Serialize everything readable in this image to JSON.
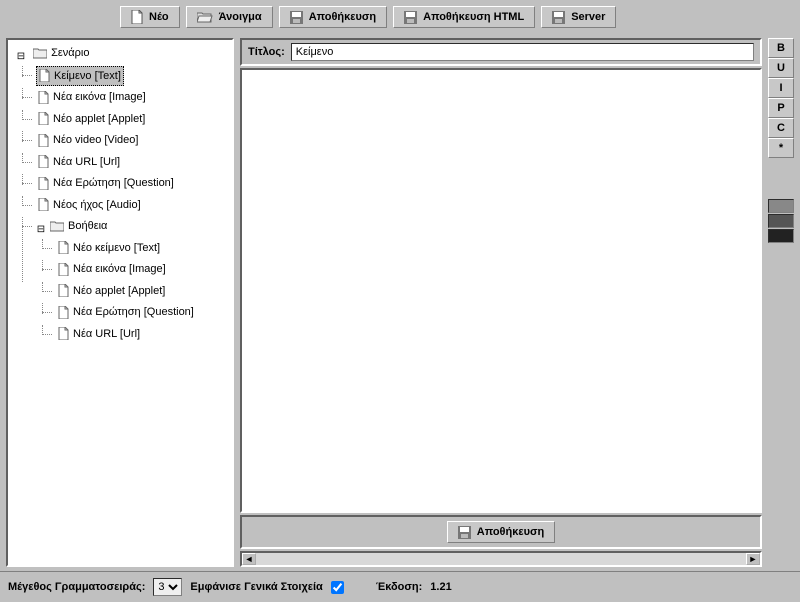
{
  "toolbar": {
    "new": "Νέο",
    "open": "Άνοιγμα",
    "save": "Αποθήκευση",
    "save_html": "Αποθήκευση ΗΤΜL",
    "server": "Server"
  },
  "tree": {
    "root": {
      "label": "Σενάριο"
    },
    "items": [
      {
        "label": "Κείμενο [Text]",
        "selected": true
      },
      {
        "label": "Νέα εικόνα [Image]"
      },
      {
        "label": "Νέο applet [Applet]"
      },
      {
        "label": "Νέο video [Video]"
      },
      {
        "label": "Νέα URL [Url]"
      },
      {
        "label": "Νέα Ερώτηση [Question]"
      },
      {
        "label": "Νέος ήχος [Audio]"
      }
    ],
    "help": {
      "label": "Βοήθεια"
    },
    "help_items": [
      {
        "label": "Νέο κείμενο [Text]"
      },
      {
        "label": "Νέα εικόνα [Image]"
      },
      {
        "label": "Νέο applet [Applet]"
      },
      {
        "label": "Νέα Ερώτηση [Question]"
      },
      {
        "label": "Νέα URL [Url]"
      }
    ]
  },
  "editor": {
    "title_label": "Τίτλος:",
    "title_value": "Κείμενο",
    "save_button": "Αποθήκευση"
  },
  "format": {
    "buttons": [
      "B",
      "U",
      "I",
      "P",
      "C",
      "*"
    ],
    "swatches": [
      "#888888",
      "#555555",
      "#222222"
    ]
  },
  "status": {
    "font_size_label": "Μέγεθος Γραμματοσειράς:",
    "font_size_value": "3",
    "show_general_label": "Εμφάνισε Γενικά Στοιχεία",
    "show_general_checked": true,
    "version_label": "Έκδοση:",
    "version_value": "1.21"
  }
}
